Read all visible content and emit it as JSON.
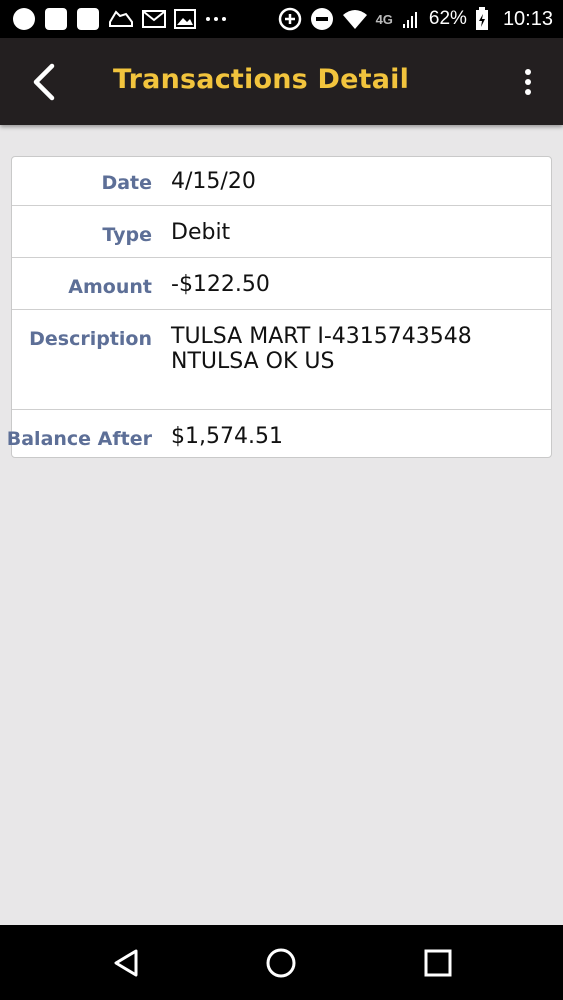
{
  "status_bar": {
    "battery": "62%",
    "clock": "10:13",
    "network": "4G",
    "left_icons": [
      "circle-notification-icon",
      "square-notification-icon",
      "square-notification-icon",
      "sneaker-icon",
      "gmail-icon",
      "image-icon",
      "more-dots-icon"
    ],
    "right_icons": [
      "add-circle-icon",
      "do-not-disturb-icon",
      "wifi-icon",
      "signal-icon",
      "battery-icon"
    ]
  },
  "app_bar": {
    "title": "Transactions Detail",
    "title_color": "#f2c43d",
    "background": "#231f20"
  },
  "detail": {
    "rows": [
      {
        "label": "Date",
        "value": "4/15/20"
      },
      {
        "label": "Type",
        "value": "Debit"
      },
      {
        "label": "Amount",
        "value": "-$122.50"
      },
      {
        "label": "Description",
        "value": "TULSA MART I-4315743548 NTULSA OK US"
      },
      {
        "label": "Balance After",
        "value": "$1,574.51"
      }
    ],
    "label_color": "#5d6f97"
  },
  "nav_bar": {
    "buttons": [
      "back-triangle-icon",
      "home-circle-icon",
      "recents-square-icon"
    ]
  }
}
